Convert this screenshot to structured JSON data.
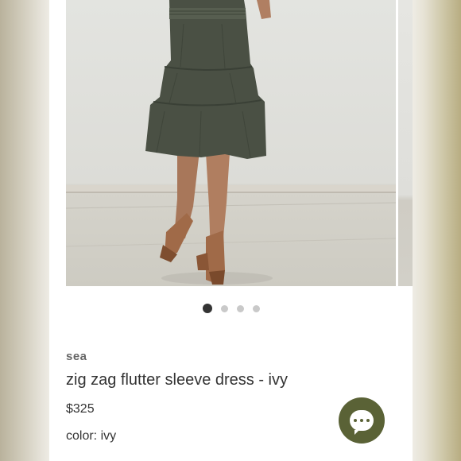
{
  "product": {
    "brand": "sea",
    "title": "zig zag flutter sleeve dress - ivy",
    "price": "$325",
    "color_label": "color: ivy"
  },
  "carousel": {
    "total_slides": 4,
    "active_slide": 1
  },
  "chat": {
    "icon": "chat-bubble-icon",
    "color": "#5a6236"
  },
  "colors": {
    "dress": "#4a5044",
    "sandals": "#a06a48",
    "active_dot": "#333333",
    "inactive_dot": "#c9c9c9"
  }
}
